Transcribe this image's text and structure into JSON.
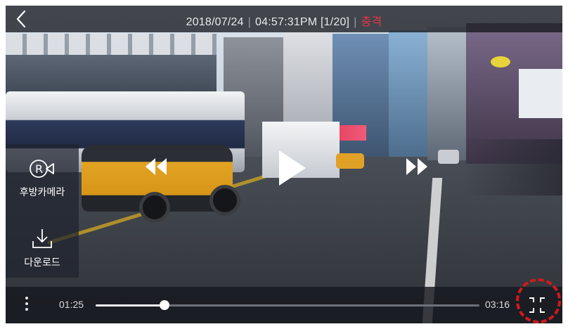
{
  "topbar": {
    "date": "2018/07/24",
    "time": "04:57:31PM",
    "index": "[1/20]",
    "event": "충격",
    "separator": "|"
  },
  "sidebar": {
    "rear_camera_label": "후방카메라",
    "download_label": "다운로드"
  },
  "player": {
    "current_time": "01:25",
    "total_time": "03:16",
    "progress": 0.18
  },
  "icons": {
    "back": "chevron-left-icon",
    "rear_camera": "rear-camera-icon",
    "download": "download-icon",
    "rewind": "rewind-icon",
    "play": "play-icon",
    "fast_forward": "fast-forward-icon",
    "more": "more-vertical-icon",
    "fullscreen_exit": "exit-fullscreen-icon"
  },
  "colors": {
    "event_red": "#e0364b",
    "highlight_ring": "#d11a1a"
  }
}
